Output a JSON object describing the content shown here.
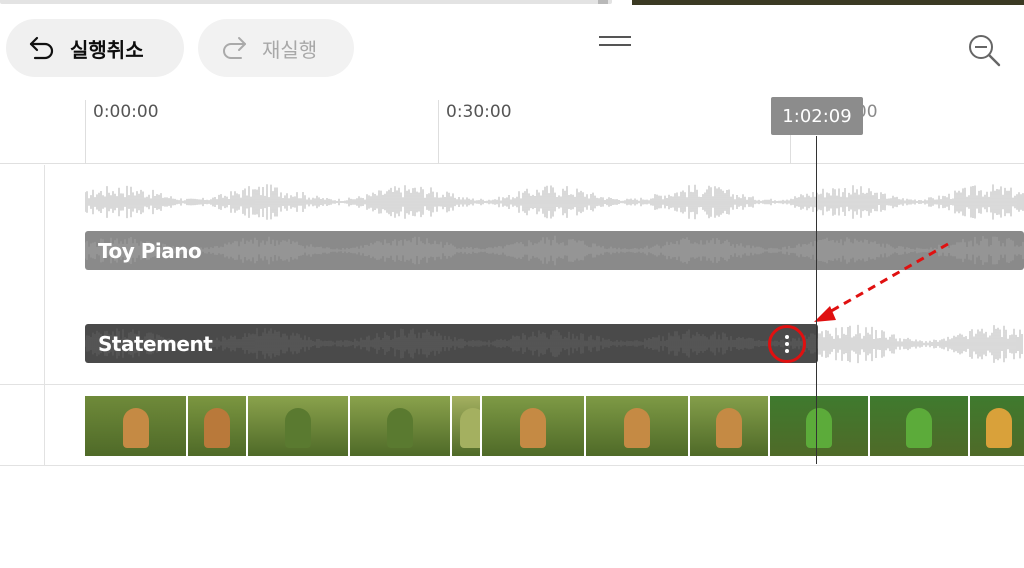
{
  "toolbar": {
    "undo_label": "실행취소",
    "redo_label": "재실행",
    "undo_icon": "undo-arrow-icon",
    "redo_icon": "redo-arrow-icon",
    "menu_icon": "drag-handle-icon",
    "zoom_icon": "zoom-out-icon"
  },
  "ruler": {
    "labels": [
      "0:00:00",
      "0:30:00"
    ],
    "ghost_label": "1:00:00"
  },
  "playhead": {
    "time": "1:02:09"
  },
  "tracks": {
    "music_clip": "Toy Piano",
    "voice_clip": "Statement",
    "more_icon": "more-vertical-icon"
  },
  "colors": {
    "music_clip": "#8a8a8a",
    "voice_clip": "#4a4a4a",
    "wave": "#c9c9c9",
    "highlight": "#e01010"
  }
}
